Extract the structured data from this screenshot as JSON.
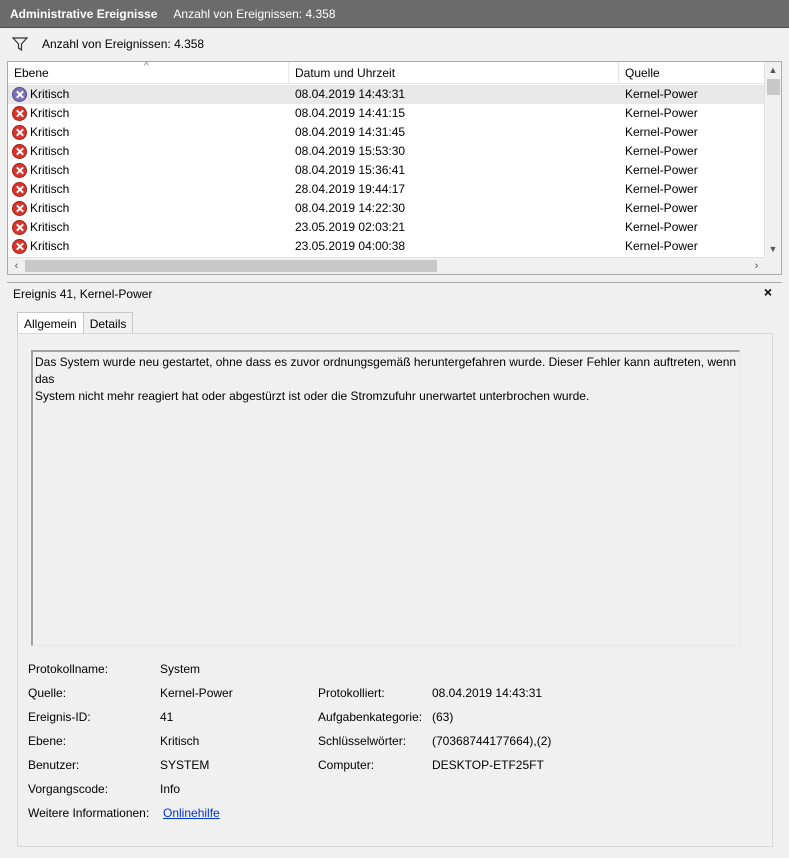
{
  "titlebar": {
    "title": "Administrative Ereignisse",
    "count_text": "Anzahl von Ereignissen: 4.358"
  },
  "filter": {
    "text": "Anzahl von Ereignissen: 4.358",
    "icon": "filter-icon"
  },
  "list": {
    "columns": [
      "Ebene",
      "Datum und Uhrzeit",
      "Quelle"
    ],
    "rows": [
      {
        "level": "Kritisch",
        "datetime": "08.04.2019 14:43:31",
        "source": "Kernel-Power"
      },
      {
        "level": "Kritisch",
        "datetime": "08.04.2019 14:41:15",
        "source": "Kernel-Power"
      },
      {
        "level": "Kritisch",
        "datetime": "08.04.2019 14:31:45",
        "source": "Kernel-Power"
      },
      {
        "level": "Kritisch",
        "datetime": "08.04.2019 15:53:30",
        "source": "Kernel-Power"
      },
      {
        "level": "Kritisch",
        "datetime": "08.04.2019 15:36:41",
        "source": "Kernel-Power"
      },
      {
        "level": "Kritisch",
        "datetime": "28.04.2019 19:44:17",
        "source": "Kernel-Power"
      },
      {
        "level": "Kritisch",
        "datetime": "08.04.2019 14:22:30",
        "source": "Kernel-Power"
      },
      {
        "level": "Kritisch",
        "datetime": "23.05.2019 02:03:21",
        "source": "Kernel-Power"
      },
      {
        "level": "Kritisch",
        "datetime": "23.05.2019 04:00:38",
        "source": "Kernel-Power"
      }
    ]
  },
  "detail": {
    "title": "Ereignis 41, Kernel-Power",
    "close": "×",
    "tabs": [
      "Allgemein",
      "Details"
    ],
    "description": "Das System wurde neu gestartet, ohne dass es zuvor ordnungsgemäß heruntergefahren wurde. Dieser Fehler kann auftreten, wenn das\nSystem nicht mehr reagiert hat oder abgestürzt ist oder die Stromzufuhr unerwartet unterbrochen wurde.",
    "fields": {
      "protokollname_label": "Protokollname:",
      "protokollname": "System",
      "quelle_label": "Quelle:",
      "quelle": "Kernel-Power",
      "ereignis_id_label": "Ereignis-ID:",
      "ereignis_id": "41",
      "ebene_label": "Ebene:",
      "ebene": "Kritisch",
      "benutzer_label": "Benutzer:",
      "benutzer": "SYSTEM",
      "vorgangscode_label": "Vorgangscode:",
      "vorgangscode": "Info",
      "weitere_label": "Weitere Informationen:",
      "weitere_link": "Onlinehilfe",
      "protokolliert_label": "Protokolliert:",
      "protokolliert": "08.04.2019 14:43:31",
      "aufgabenkategorie_label": "Aufgabenkategorie:",
      "aufgabenkategorie": "(63)",
      "schluesselwoerter_label": "Schlüsselwörter:",
      "schluesselwoerter": "(70368744177664),(2)",
      "computer_label": "Computer:",
      "computer": "DESKTOP-ETF25FT"
    }
  }
}
